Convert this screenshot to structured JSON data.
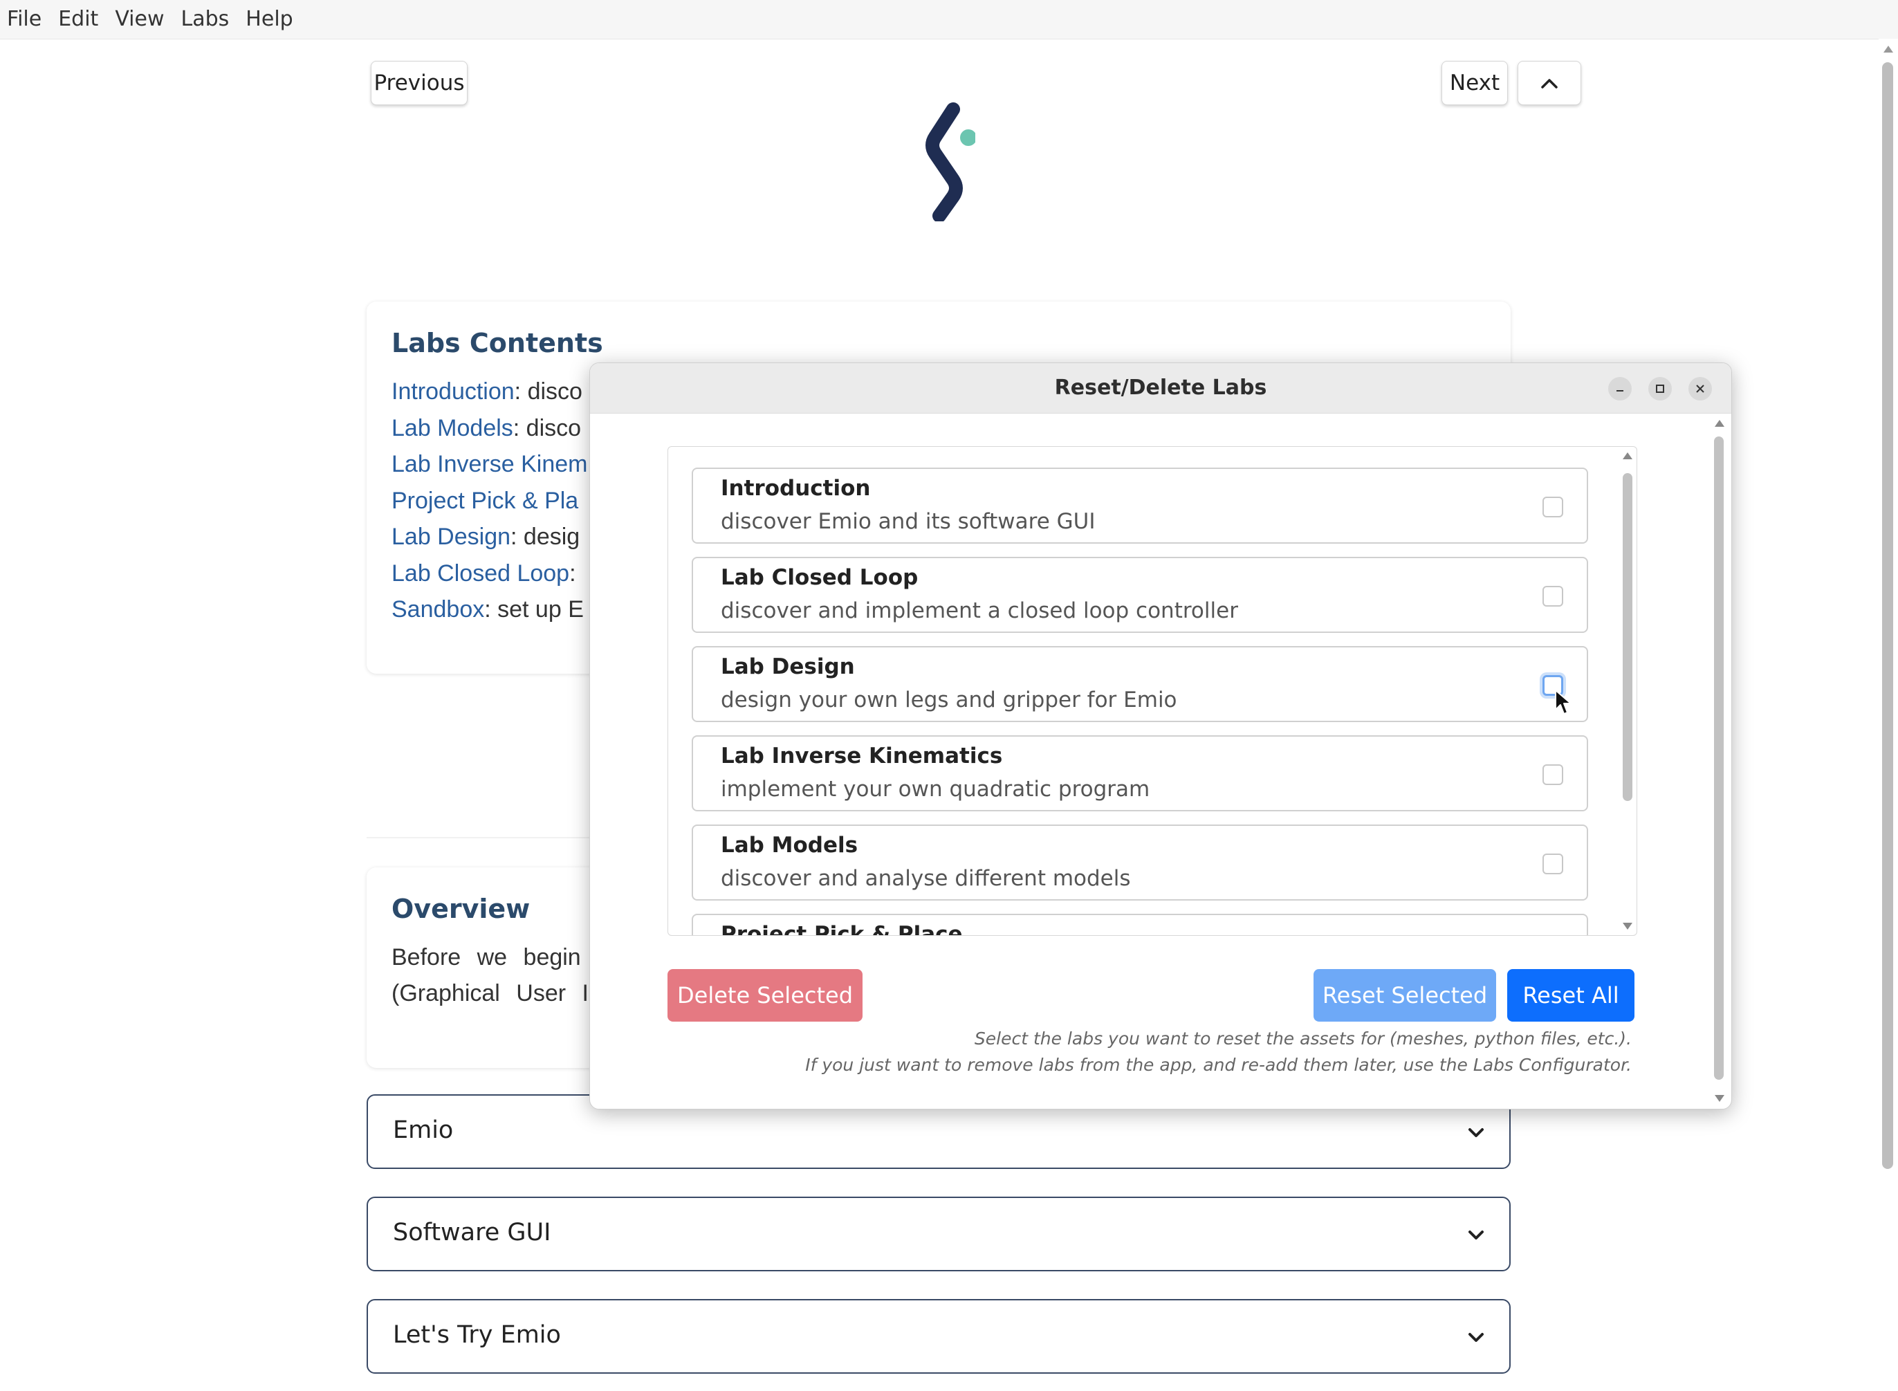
{
  "menubar": {
    "items": [
      "File",
      "Edit",
      "View",
      "Labs",
      "Help"
    ]
  },
  "nav": {
    "previous_label": "Previous",
    "next_label": "Next",
    "up_icon": "chevron-up-icon"
  },
  "logo": {
    "name": "emio-logo",
    "colors": [
      "#1f2d52",
      "#6cc5b0"
    ]
  },
  "labs_contents": {
    "title": "Labs Contents",
    "items": [
      {
        "link": "Introduction",
        "desc": ": disco"
      },
      {
        "link": "Lab Models",
        "desc": ": disco"
      },
      {
        "link": "Lab Inverse Kinem",
        "desc": ""
      },
      {
        "link": "Project Pick & Pla",
        "desc": ""
      },
      {
        "link": "Lab Design",
        "desc": ": desig"
      },
      {
        "link": "Lab Closed Loop",
        "desc": ":"
      },
      {
        "link": "Sandbox",
        "desc": ": set up E"
      }
    ]
  },
  "overview": {
    "title": "Overview",
    "text_line1": "Before we begin",
    "text_line2": "(Graphical User In"
  },
  "accordions": [
    {
      "label": "Emio"
    },
    {
      "label": "Software GUI"
    },
    {
      "label": "Let's Try Emio"
    }
  ],
  "dialog": {
    "title": "Reset/Delete Labs",
    "labs": [
      {
        "name": "Introduction",
        "desc": "discover Emio and its software GUI",
        "checked": false
      },
      {
        "name": "Lab Closed Loop",
        "desc": "discover and implement a closed loop controller",
        "checked": false
      },
      {
        "name": "Lab Design",
        "desc": "design your own legs and gripper for Emio",
        "checked": false
      },
      {
        "name": "Lab Inverse Kinematics",
        "desc": "implement your own quadratic program",
        "checked": false
      },
      {
        "name": "Lab Models",
        "desc": "discover and analyse different models",
        "checked": false
      },
      {
        "name": "Project Pick & Place",
        "desc": "",
        "checked": false
      }
    ],
    "delete_label": "Delete Selected",
    "reset_selected_label": "Reset Selected",
    "reset_all_label": "Reset All",
    "hint_line1": "Select the labs you want to reset the assets for (meshes, python files, etc.).",
    "hint_line2": "If you just want to remove labs from the app, and re-add them later, use the Labs Configurator.",
    "colors": {
      "delete": "#e57982",
      "reset_selected": "#6ea9f7",
      "reset_all": "#0d6efd"
    }
  }
}
